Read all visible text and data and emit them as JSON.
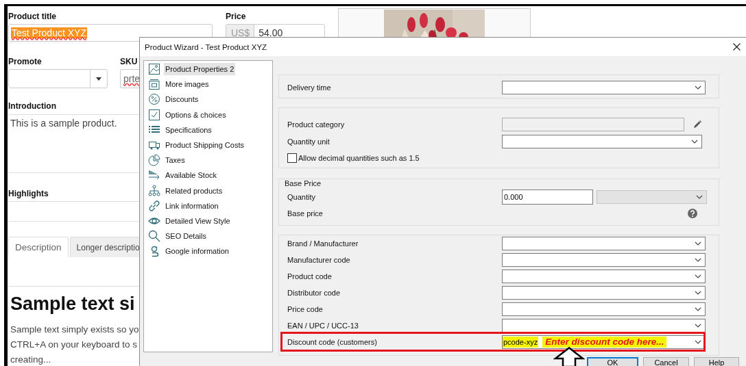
{
  "product_form": {
    "title_label": "Product title",
    "title_value": "Test Product XYZ",
    "title_selected": true,
    "price_label": "Price",
    "price_currency": "US$",
    "price_value": "54.00",
    "promote_label": "Promote",
    "sku_label": "SKU",
    "sku_value": "prte",
    "introduction_label": "Introduction",
    "introduction_value": "This is a sample product.",
    "highlights_label": "Highlights",
    "tabs": [
      {
        "label": "Description",
        "selected": true
      },
      {
        "label": "Longer descriptio",
        "selected": false
      }
    ],
    "content_heading": "Sample text si",
    "content_lines": [
      "Sample text simply exists so yo",
      "CTRL+A on your keyboard to s",
      "creating..."
    ],
    "image": {
      "kind": "picture"
    }
  },
  "wizard": {
    "title": "Product Wizard - Test Product XYZ",
    "nav": [
      {
        "label": "Product Properties 2",
        "selected": true
      },
      {
        "label": "More images",
        "selected": false
      },
      {
        "label": "Discounts",
        "selected": false
      },
      {
        "label": "Options & choices",
        "selected": false
      },
      {
        "label": "Specifications",
        "selected": false
      },
      {
        "label": "Product Shipping Costs",
        "selected": false
      },
      {
        "label": "Taxes",
        "selected": false
      },
      {
        "label": "Available Stock",
        "selected": false
      },
      {
        "label": "Related products",
        "selected": false
      },
      {
        "label": "Link information",
        "selected": false
      },
      {
        "label": "Detailed View Style",
        "selected": false
      },
      {
        "label": "SEO Details",
        "selected": false
      },
      {
        "label": "Google information",
        "selected": false
      }
    ],
    "groups": [
      {
        "rows": [
          {
            "kind": "combo",
            "label": "Delivery time"
          }
        ]
      },
      {
        "rows": [
          {
            "kind": "readonly",
            "label": "Product category"
          },
          {
            "kind": "combo",
            "label": "Quantity unit"
          },
          {
            "kind": "checkbox",
            "label": "Allow decimal quantities such as 1.5",
            "checked": false
          }
        ]
      },
      {
        "legend": "Base Price",
        "rows": [
          {
            "kind": "number_unit",
            "label": "Quantity",
            "value": "0.000"
          },
          {
            "kind": "help",
            "label": "Base price"
          }
        ]
      },
      {
        "rows": [
          {
            "kind": "combo",
            "label": "Brand / Manufacturer"
          },
          {
            "kind": "combo",
            "label": "Manufacturer code"
          },
          {
            "kind": "combo",
            "label": "Product code"
          },
          {
            "kind": "combo",
            "label": "Distributor code"
          },
          {
            "kind": "combo",
            "label": "Price code"
          },
          {
            "kind": "combo",
            "label": "EAN / UPC / UCC-13"
          },
          {
            "kind": "combo",
            "label": "Discount code (customers)",
            "value": "pcode-xyz",
            "highlighted": true,
            "annotation": "Enter discount code here..."
          }
        ]
      }
    ],
    "buttons": [
      {
        "label": "OK",
        "default": true
      },
      {
        "label": "Cancel",
        "default": false
      },
      {
        "label": "Help",
        "default": false
      }
    ]
  }
}
